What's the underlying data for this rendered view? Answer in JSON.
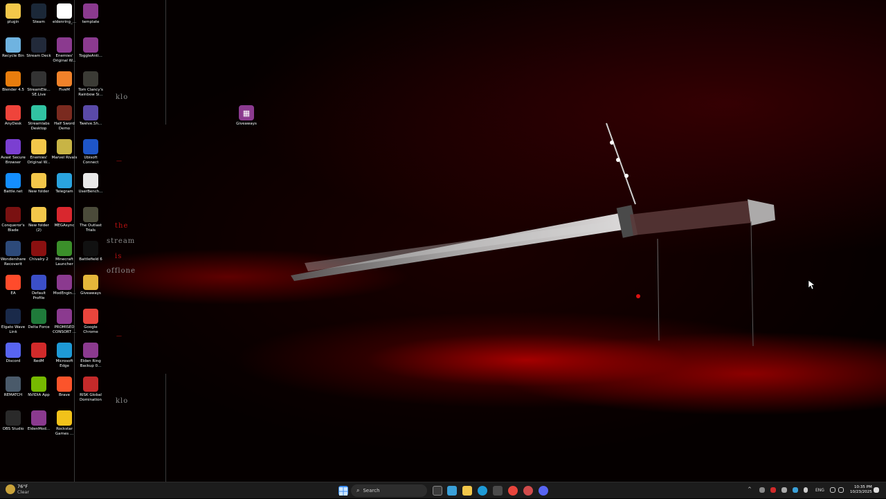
{
  "desktop": {
    "icons": [
      {
        "label": "plugin",
        "icon": "folder-icon",
        "color": "#f3c74a"
      },
      {
        "label": "Steam",
        "icon": "steam-icon",
        "color": "#1b2838"
      },
      {
        "label": "eldenring_...",
        "icon": "file-icon",
        "color": "#ffffff"
      },
      {
        "label": "template",
        "icon": "winrar-icon",
        "color": "#8b3a8f"
      },
      {
        "label": "Recycle Bin",
        "icon": "recycle-bin-icon",
        "color": "#6fb3e0"
      },
      {
        "label": "Stream Deck",
        "icon": "stream-deck-icon",
        "color": "#222a3a"
      },
      {
        "label": "Enemies' Original W...",
        "icon": "winrar-icon",
        "color": "#8b3a8f"
      },
      {
        "label": "ToggleAnti...",
        "icon": "winrar-icon",
        "color": "#8b3a8f"
      },
      {
        "label": "Blender 4.5",
        "icon": "blender-icon",
        "color": "#e87d0d"
      },
      {
        "label": "StreamEle... SE.Live",
        "icon": "streamelements-icon",
        "color": "#333"
      },
      {
        "label": "FiveM",
        "icon": "fivem-icon",
        "color": "#f0822a"
      },
      {
        "label": "Tom Clancy's Rainbow Si...",
        "icon": "rainbow-six-icon",
        "color": "#3b3b35"
      },
      {
        "label": "AnyDesk",
        "icon": "anydesk-icon",
        "color": "#ef443b"
      },
      {
        "label": "Streamlabs Desktop",
        "icon": "streamlabs-icon",
        "color": "#31c3a2"
      },
      {
        "label": "Half Sword Demo",
        "icon": "half-sword-icon",
        "color": "#7a2a1f"
      },
      {
        "label": "Twelve.Sh...",
        "icon": "twelve-icon",
        "color": "#5a4aa8"
      },
      {
        "label": "Avast Secure Browser",
        "icon": "avast-icon",
        "color": "#7b3fd1"
      },
      {
        "label": "Enemies' Original W...",
        "icon": "folder-icon",
        "color": "#f3c74a"
      },
      {
        "label": "Marvel Rivals",
        "icon": "marvel-rivals-icon",
        "color": "#c8b445"
      },
      {
        "label": "Ubisoft Connect",
        "icon": "ubisoft-icon",
        "color": "#1e55c7"
      },
      {
        "label": "Battle.net",
        "icon": "battlenet-icon",
        "color": "#148eff"
      },
      {
        "label": "New folder",
        "icon": "folder-icon",
        "color": "#f3c74a"
      },
      {
        "label": "Telegram",
        "icon": "telegram-icon",
        "color": "#2aa3de"
      },
      {
        "label": "UserBench...",
        "icon": "userbenchmark-icon",
        "color": "#e8e8e8"
      },
      {
        "label": "Conqueror's Blade",
        "icon": "conquerors-blade-icon",
        "color": "#7a1111"
      },
      {
        "label": "New folder (2)",
        "icon": "folder-icon",
        "color": "#f3c74a"
      },
      {
        "label": "MEGAsync",
        "icon": "mega-icon",
        "color": "#d9272e"
      },
      {
        "label": "The Outlast Trials",
        "icon": "outlast-icon",
        "color": "#4b4b3a"
      },
      {
        "label": "Wondershare Recoverit",
        "icon": "recoverit-icon",
        "color": "#2d4a7a"
      },
      {
        "label": "Chivalry 2",
        "icon": "chivalry-icon",
        "color": "#8a1010"
      },
      {
        "label": "Minecraft Launcher",
        "icon": "minecraft-icon",
        "color": "#3b8f2a"
      },
      {
        "label": "Battlefield 6",
        "icon": "battlefield-icon",
        "color": "#111111"
      },
      {
        "label": "EA",
        "icon": "ea-icon",
        "color": "#ff4b2b"
      },
      {
        "label": "Default Profile",
        "icon": "profile-icon",
        "color": "#3b4fc8"
      },
      {
        "label": "ModEngin...",
        "icon": "winrar-icon",
        "color": "#8b3a8f"
      },
      {
        "label": "Giveaways",
        "icon": "folder-open-icon",
        "color": "#e6b63a"
      },
      {
        "label": "Elgato Wave Link",
        "icon": "wave-link-icon",
        "color": "#1a2a4a"
      },
      {
        "label": "Delta Force",
        "icon": "delta-force-icon",
        "color": "#1f7a3a"
      },
      {
        "label": "PROMISED CONSORT ...",
        "icon": "winrar-icon",
        "color": "#8b3a8f"
      },
      {
        "label": "Google Chrome",
        "icon": "chrome-icon",
        "color": "#e8453c"
      },
      {
        "label": "Discord",
        "icon": "discord-icon",
        "color": "#5865f2"
      },
      {
        "label": "RedM",
        "icon": "redm-icon",
        "color": "#d12a2a"
      },
      {
        "label": "Microsoft Edge",
        "icon": "edge-icon",
        "color": "#1e9ad6"
      },
      {
        "label": "Elden Ring Backup 0...",
        "icon": "winrar-icon",
        "color": "#8b3a8f"
      },
      {
        "label": "REMATCH",
        "icon": "rematch-icon",
        "color": "#4a5a6a"
      },
      {
        "label": "NVIDIA App",
        "icon": "nvidia-icon",
        "color": "#76b900"
      },
      {
        "label": "Brave",
        "icon": "brave-icon",
        "color": "#fb542b"
      },
      {
        "label": "RISK Global Domination",
        "icon": "risk-icon",
        "color": "#c42a2a"
      },
      {
        "label": "OBS Studio",
        "icon": "obs-icon",
        "color": "#2a2a2a"
      },
      {
        "label": "EldenMod...",
        "icon": "winrar-icon",
        "color": "#8b3a8f"
      },
      {
        "label": "Rockstar Games ...",
        "icon": "rockstar-icon",
        "color": "#f2c21a"
      }
    ],
    "floating_icon": {
      "label": "Giveaways",
      "icon": "winrar-icon",
      "color": "#8b3a8f"
    },
    "overlay_text": {
      "klo_top": "klo",
      "the": "the",
      "stream": "stream",
      "is": "is",
      "offline": "offlone",
      "klo_bottom": "klo"
    }
  },
  "taskbar": {
    "weather_temp": "76°F",
    "weather_desc": "Clear",
    "search_placeholder": "Search",
    "language": "ENG",
    "time": "10:35 PM",
    "date": "10/23/2025",
    "colors": {
      "start": "#3a8cf0",
      "explorer": "#f3c74a",
      "edge": "#1e9ad6",
      "chrome": "#e8453c"
    }
  }
}
